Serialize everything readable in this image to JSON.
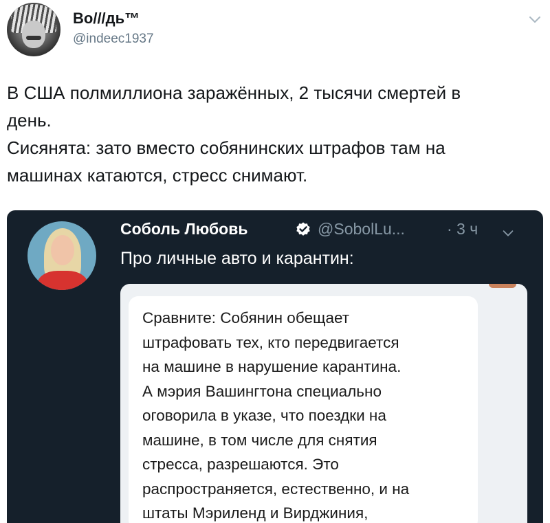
{
  "outer_tweet": {
    "author_name": "Во///дь™",
    "author_handle": "@indeec1937",
    "text_lines": [
      "В США полмиллиона заражённых, 2 тысячи смертей в",
      "день.",
      "Сисянята: зато вместо собянинских штрафов там на",
      "машинах катаются, стресс снимают."
    ],
    "menu_icon": "chevron-down-icon"
  },
  "quoted_tweet": {
    "author_name": "Соболь Любовь",
    "verified_icon": "verified-badge-icon",
    "author_handle": "@SobolLu...",
    "time": "· 3 ч",
    "text": "Про личные авто и карантин:",
    "menu_icon": "chevron-down-icon"
  },
  "attached_screenshot": {
    "message_lines": [
      "Сравните: Собянин обещает",
      "штрафовать тех, кто передвигается",
      "на машине в нарушение карантина.",
      "А мэрия Вашингтона специально",
      "оговорила в указе, что поездки на",
      "машине, в том числе для снятия",
      "стресса, разрешаются. Это",
      "распространяется, естественно, и на",
      "штаты Мэриленд и Вирджиния,"
    ]
  },
  "colors": {
    "card_background": "#15202b",
    "secondary_text": "#8899a6",
    "verified_blue": "#1da1f2"
  }
}
